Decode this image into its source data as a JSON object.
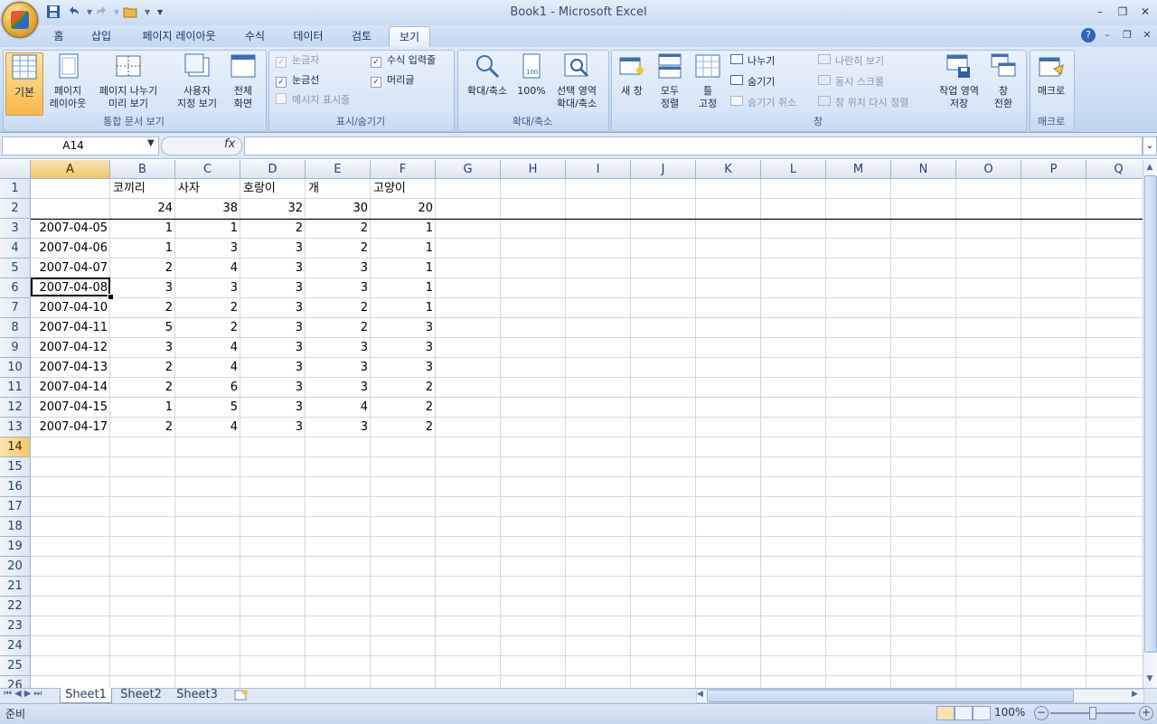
{
  "window": {
    "title": "Book1  -  Microsoft Excel"
  },
  "quick_access": {
    "save_icon": "save-icon",
    "undo_icon": "undo-icon",
    "redo_icon": "redo-icon",
    "open_icon": "open-icon",
    "customize_icon": "customize-icon"
  },
  "tabs": [
    {
      "label": "홈"
    },
    {
      "label": "삽입"
    },
    {
      "label": "페이지 레이아웃"
    },
    {
      "label": "수식"
    },
    {
      "label": "데이터"
    },
    {
      "label": "검토"
    },
    {
      "label": "보기"
    }
  ],
  "ribbon": {
    "workbook_views": {
      "label": "통합 문서 보기",
      "normal": "기본",
      "page_layout_1": "페이지",
      "page_layout_2": "레이아웃",
      "page_break_1": "페이지 나누기",
      "page_break_2": "미리 보기",
      "custom_1": "사용자",
      "custom_2": "지정 보기",
      "full_1": "전체",
      "full_2": "화면"
    },
    "show_hide": {
      "label": "표시/숨기기",
      "ruler": "눈금자",
      "gridlines": "눈금선",
      "message_bar": "메시지 표시줄",
      "formula_bar": "수식 입력줄",
      "headings": "머리글",
      "check_mark": "✓"
    },
    "zoom": {
      "label": "확대/축소",
      "zoom": "확대/축소",
      "hundred": "100%",
      "sel_1": "선택 영역",
      "sel_2": "확대/축소"
    },
    "window": {
      "label": "창",
      "new_window": "새 창",
      "arrange_1": "모두",
      "arrange_2": "정렬",
      "freeze_1": "틀",
      "freeze_2": "고정",
      "split": "나누기",
      "hide": "숨기기",
      "unhide": "숨기기 취소",
      "side_by_side": "나란히 보기",
      "sync_scroll": "동시 스크롤",
      "reset_pos": "창 위치 다시 정렬",
      "save_ws_1": "작업 영역",
      "save_ws_2": "저장",
      "switch_1": "창",
      "switch_2": "전환"
    },
    "macros": {
      "label": "매크로",
      "macros": "매크로"
    }
  },
  "formula_bar": {
    "name_box": "A14",
    "fx": "fx",
    "value": ""
  },
  "columns": [
    "A",
    "B",
    "C",
    "D",
    "E",
    "F",
    "G",
    "H",
    "I",
    "J",
    "K",
    "L",
    "M",
    "N",
    "O",
    "P",
    "Q"
  ],
  "rows": [
    "1",
    "2",
    "3",
    "4",
    "5",
    "6",
    "7",
    "8",
    "9",
    "10",
    "11",
    "12",
    "13",
    "14",
    "15",
    "16",
    "17",
    "18",
    "19",
    "20",
    "21",
    "22",
    "23",
    "24",
    "25",
    "26"
  ],
  "sheet": {
    "header_row": [
      "",
      "코끼리",
      "사자",
      "호랑이",
      "개",
      "고양이"
    ],
    "totals_row": [
      "",
      "24",
      "38",
      "32",
      "30",
      "20"
    ],
    "data": [
      [
        "2007-04-05",
        "1",
        "1",
        "2",
        "2",
        "1"
      ],
      [
        "2007-04-06",
        "1",
        "3",
        "3",
        "2",
        "1"
      ],
      [
        "2007-04-07",
        "2",
        "4",
        "3",
        "3",
        "1"
      ],
      [
        "2007-04-08",
        "3",
        "3",
        "3",
        "3",
        "1"
      ],
      [
        "2007-04-10",
        "2",
        "2",
        "3",
        "2",
        "1"
      ],
      [
        "2007-04-11",
        "5",
        "2",
        "3",
        "2",
        "3"
      ],
      [
        "2007-04-12",
        "3",
        "4",
        "3",
        "3",
        "3"
      ],
      [
        "2007-04-13",
        "2",
        "4",
        "3",
        "3",
        "3"
      ],
      [
        "2007-04-14",
        "2",
        "6",
        "3",
        "3",
        "2"
      ],
      [
        "2007-04-15",
        "1",
        "5",
        "3",
        "4",
        "2"
      ],
      [
        "2007-04-17",
        "2",
        "4",
        "3",
        "3",
        "2"
      ]
    ]
  },
  "sheet_tabs": [
    "Sheet1",
    "Sheet2",
    "Sheet3"
  ],
  "status": {
    "ready": "준비",
    "zoom": "100%"
  },
  "colors": {
    "accent": "#f3c66a",
    "ribbon": "#c8dbf3",
    "grid": "#d0d7e5"
  }
}
